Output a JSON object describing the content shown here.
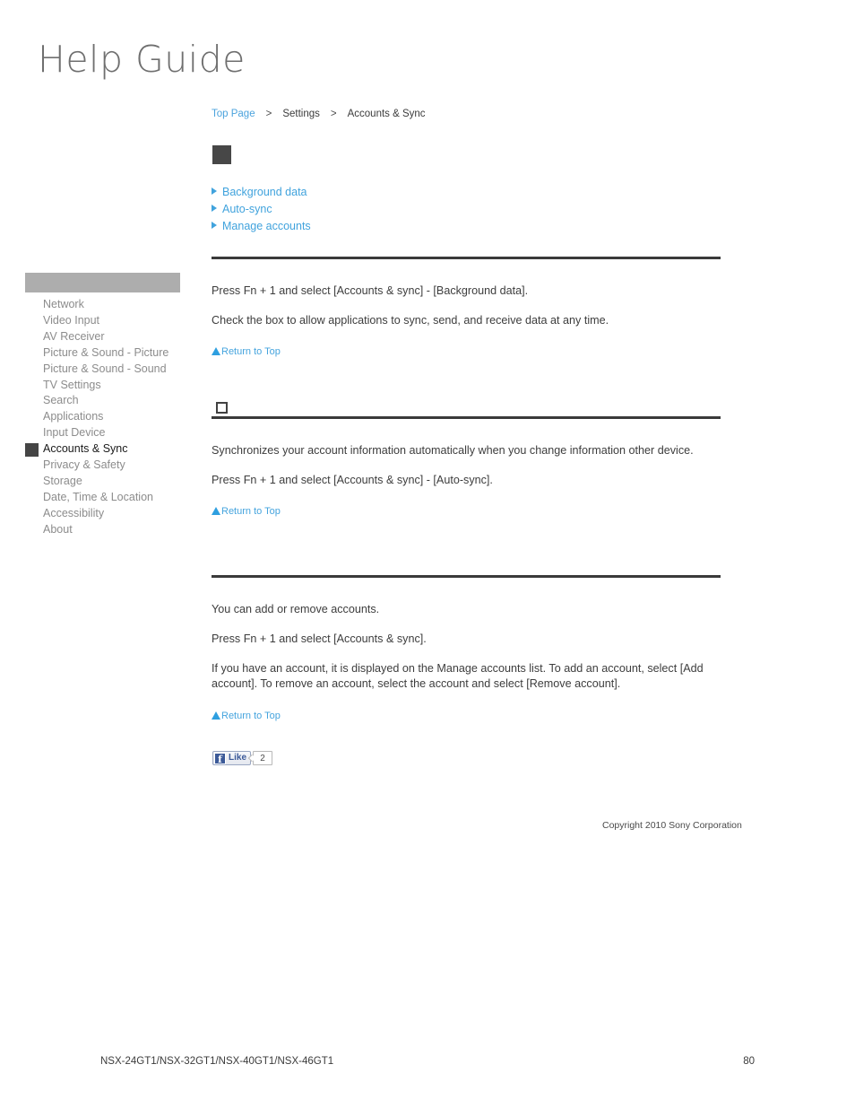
{
  "logo": {
    "text": "Help Guide"
  },
  "breadcrumb": {
    "items": [
      {
        "label": "Top Page",
        "type": "link"
      },
      {
        "label": "Settings",
        "type": "text"
      },
      {
        "label": "Accounts & Sync",
        "type": "text"
      }
    ],
    "separator": ">"
  },
  "sidebar": {
    "header_label": "",
    "items": [
      {
        "label": "Network",
        "active": false
      },
      {
        "label": "Video Input",
        "active": false
      },
      {
        "label": "AV Receiver",
        "active": false
      },
      {
        "label": "Picture & Sound - Picture",
        "active": false
      },
      {
        "label": "Picture & Sound - Sound",
        "active": false
      },
      {
        "label": "TV Settings",
        "active": false
      },
      {
        "label": "Search",
        "active": false
      },
      {
        "label": "Applications",
        "active": false
      },
      {
        "label": "Input Device",
        "active": false
      },
      {
        "label": "Accounts & Sync",
        "active": true
      },
      {
        "label": "Privacy & Safety",
        "active": false
      },
      {
        "label": "Storage",
        "active": false
      },
      {
        "label": "Date, Time & Location",
        "active": false
      },
      {
        "label": "Accessibility",
        "active": false
      },
      {
        "label": "About",
        "active": false
      }
    ]
  },
  "jump_links": [
    {
      "label": "Background data"
    },
    {
      "label": "Auto-sync"
    },
    {
      "label": "Manage accounts"
    }
  ],
  "sections": [
    {
      "id": "background-data",
      "heading": "",
      "paragraphs": [
        "Press Fn + 1 and select [Accounts & sync] - [Background data].",
        "Check the box to allow applications to sync, send, and receive data at any time."
      ],
      "return_to_top": "Return to Top"
    },
    {
      "id": "auto-sync",
      "heading": "",
      "paragraphs": [
        "Synchronizes your account information automatically when you change information other device.",
        "Press Fn + 1 and select [Accounts & sync] - [Auto-sync]."
      ],
      "return_to_top": "Return to Top"
    },
    {
      "id": "manage-accounts",
      "heading": "",
      "paragraphs": [
        "You can add or remove accounts.",
        "Press Fn + 1 and select [Accounts & sync].",
        "If you have an account, it is displayed on the Manage accounts list. To add an account, select [Add account]. To remove an account, select the account and select [Remove account]."
      ],
      "return_to_top": "Return to Top"
    }
  ],
  "social": {
    "like_label": "Like",
    "facebook_glyph": "f",
    "count": "2"
  },
  "copyright": {
    "text": "Copyright 2010 Sony Corporation"
  },
  "footer": {
    "models": "NSX-24GT1/NSX-32GT1/NSX-40GT1/NSX-46GT1",
    "page_number": "80"
  },
  "colors": {
    "link_blue": "#41a3dd",
    "rule_dark": "#3a3a3a",
    "sidebar_header_gray": "#adadad",
    "active_marker": "#454545",
    "facebook_blue": "#3b5998"
  }
}
